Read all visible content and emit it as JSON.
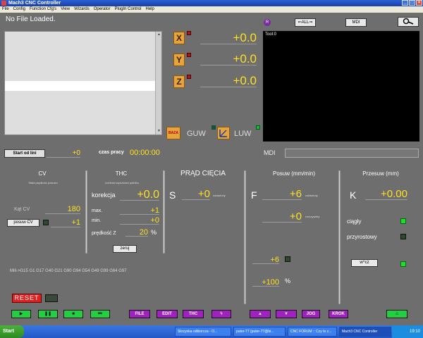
{
  "window": {
    "title": "Mach3 CNC Controller"
  },
  "menu": [
    "File",
    "Config",
    "Function Cfg's",
    "View",
    "Wizards",
    "Operator",
    "PlugIn Control",
    "Help"
  ],
  "status": {
    "file": "No File Loaded."
  },
  "top_buttons": {
    "ref": "R",
    "all": "ALL",
    "mdi": "MDI"
  },
  "axes": [
    {
      "label": "X",
      "value": "+0.0"
    },
    {
      "label": "Y",
      "value": "+0.0"
    },
    {
      "label": "Z",
      "value": "+0.0"
    }
  ],
  "toolpath": {
    "tool": "Tool:0"
  },
  "coords": {
    "baza": "BAZA",
    "guw": "GUW",
    "luw": "LUW"
  },
  "job": {
    "start_label": "Start od lini",
    "start_value": "+0",
    "time_label": "czas pracy",
    "time_value": "00:00:00",
    "mdi_label": "MDI"
  },
  "cv": {
    "title": "CV",
    "subtitle": "Stała prędkość posuwu",
    "angle_label": "Kąt CV",
    "angle_value": "180",
    "button": "posuw CV",
    "value": "+1"
  },
  "thc": {
    "title": "THC",
    "subtitle": "kontrola wysokości palnika",
    "korekcja_label": "korekcja",
    "korekcja_value": "+0.0",
    "max_label": "max.",
    "max_value": "+1",
    "min_label": "min.",
    "min_value": "+0",
    "speed_label": "prędkość Z",
    "speed_value": "20",
    "speed_unit": "%",
    "zero_button": "zeruj"
  },
  "current": {
    "title": "PRĄD CIĘCIA",
    "letter": "S",
    "value": "+0",
    "unit": "ustawiony"
  },
  "feed": {
    "title": "Posuw (mm/min)",
    "letter": "F",
    "set_value": "+6",
    "set_label": "ustawiony",
    "actual_value": "+0",
    "actual_label": "rzeczywisty",
    "value3": "+6",
    "override": "+100",
    "override_unit": "%"
  },
  "jog": {
    "title": "Przesuw (mm)",
    "letter": "K",
    "value": "+0.00",
    "continuous": "ciągły",
    "incremental": "przyrostowy",
    "button": "w^cz"
  },
  "gcodes": "Mill->G15  G1 G17 G40 G21 G90 G94 G54 G49 G99 G64 G97",
  "controls": {
    "reset": "RESET",
    "file": "FILE",
    "edit": "EDIT",
    "thc": "THC",
    "jog": "JOG",
    "krok": "KROK"
  },
  "taskbar": {
    "start": "Start",
    "tasks": [
      "Skrzynka odbiorcza - O...",
      "puter-77 (puter-77@bi...",
      "CNC FORUM :: Czy to z...",
      "Mach3 CNC Controller"
    ],
    "clock": "19:10"
  }
}
